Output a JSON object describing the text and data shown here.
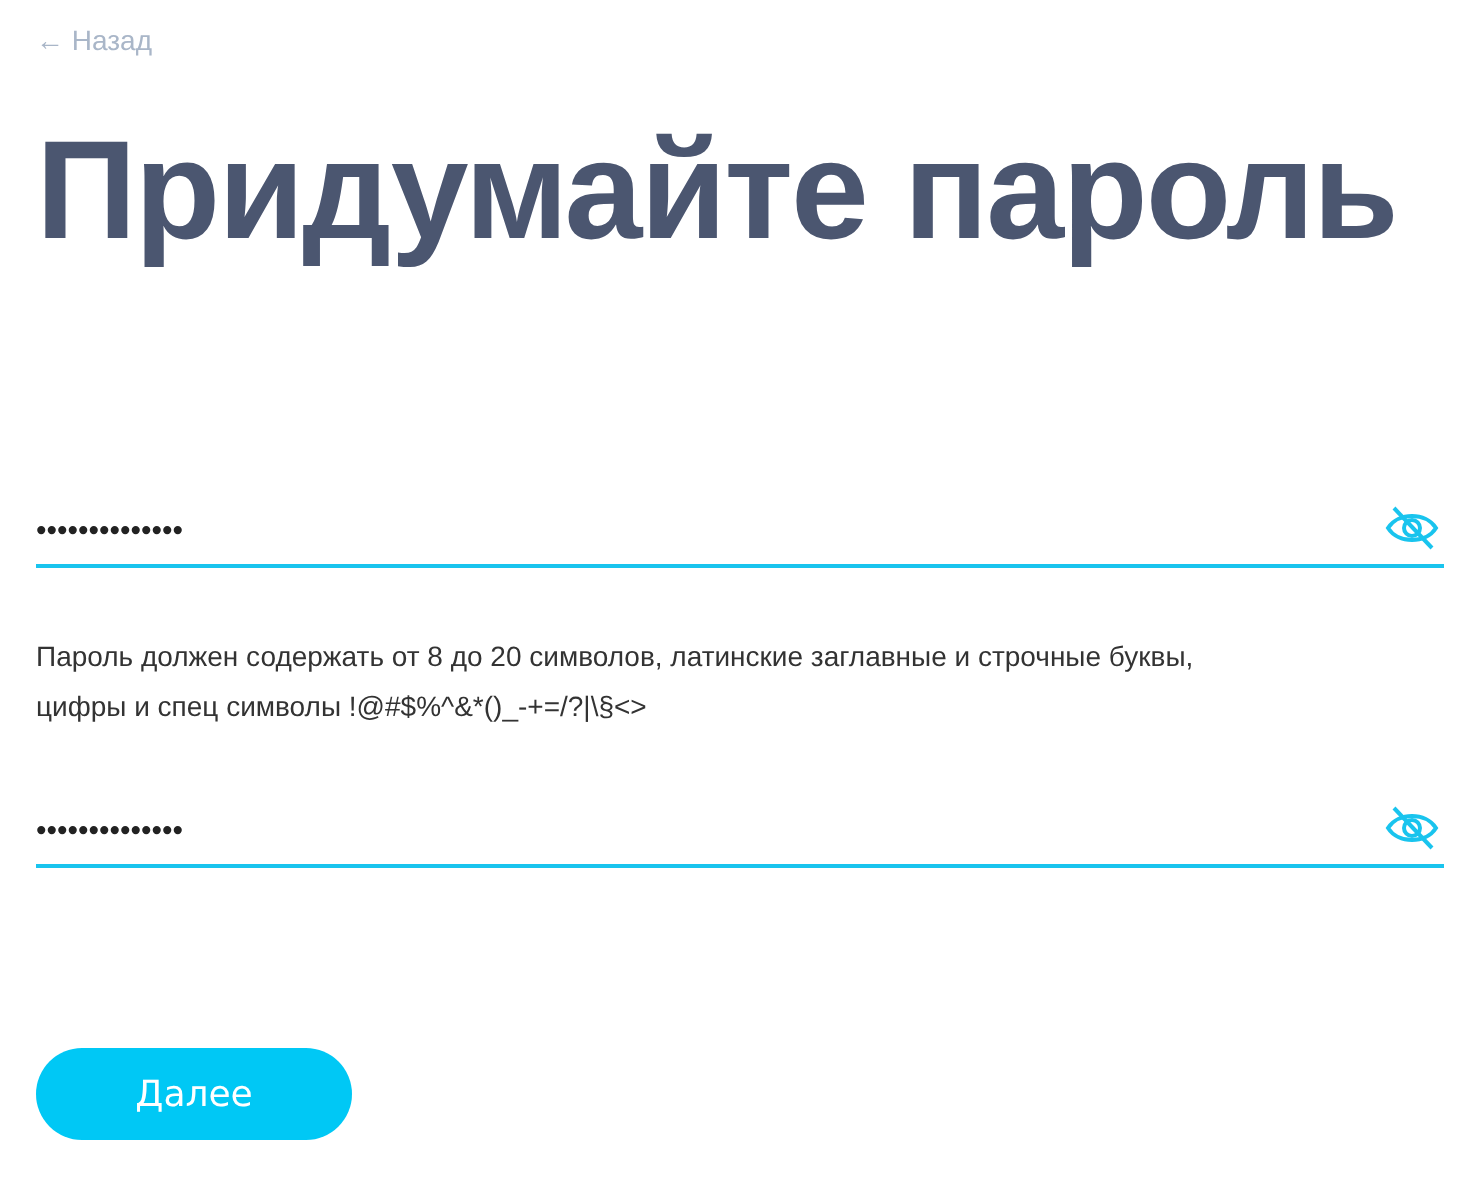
{
  "back_link": {
    "arrow": "←",
    "label": "Назад"
  },
  "title": "Придумайте пароль",
  "fields": [
    {
      "value": "••••••••••••••",
      "masked": true
    },
    {
      "value": "••••••••••••••",
      "masked": true
    }
  ],
  "hint": "Пароль должен содержать от 8 до 20 символов, латинские заглавные и строчные буквы, цифры и спец символы !@#$%^&*()_-+=/?|\\§<>",
  "next_button": {
    "label": "Далее"
  }
}
